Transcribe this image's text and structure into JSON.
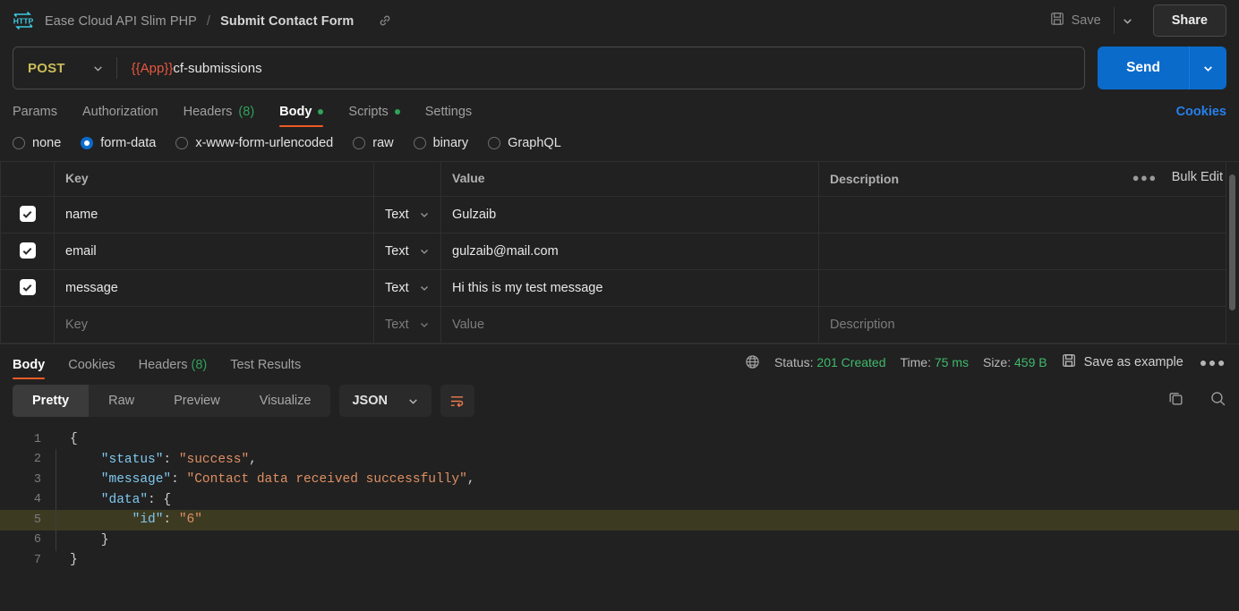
{
  "topbar": {
    "logo_icon": "http-logo-icon",
    "collection": "Ease Cloud API Slim PHP",
    "separator": "/",
    "request_name": "Submit Contact Form",
    "link_icon": "link-icon",
    "save_label": "Save",
    "save_icon": "floppy-disk-icon",
    "save_caret_icon": "chevron-down-icon",
    "share_label": "Share"
  },
  "url": {
    "method": "POST",
    "method_caret_icon": "chevron-down-icon",
    "variable": "{{App}}",
    "path": "cf-submissions",
    "send_label": "Send",
    "send_caret_icon": "chevron-down-icon"
  },
  "request_tabs": {
    "items": [
      {
        "label": "Params",
        "count": "",
        "dot": false,
        "active": false
      },
      {
        "label": "Authorization",
        "count": "",
        "dot": false,
        "active": false
      },
      {
        "label": "Headers",
        "count": "(8)",
        "dot": false,
        "active": false
      },
      {
        "label": "Body",
        "count": "",
        "dot": true,
        "active": true
      },
      {
        "label": "Scripts",
        "count": "",
        "dot": true,
        "active": false
      },
      {
        "label": "Settings",
        "count": "",
        "dot": false,
        "active": false
      }
    ],
    "cookies_label": "Cookies"
  },
  "body_types": [
    {
      "label": "none",
      "selected": false
    },
    {
      "label": "form-data",
      "selected": true
    },
    {
      "label": "x-www-form-urlencoded",
      "selected": false
    },
    {
      "label": "raw",
      "selected": false
    },
    {
      "label": "binary",
      "selected": false
    },
    {
      "label": "GraphQL",
      "selected": false
    }
  ],
  "form_table": {
    "headers": {
      "key": "Key",
      "value": "Value",
      "description": "Description"
    },
    "more_icon": "ellipsis-icon",
    "bulk_edit_label": "Bulk Edit",
    "rows": [
      {
        "checked": true,
        "key": "name",
        "type": "Text",
        "value": "Gulzaib",
        "description": ""
      },
      {
        "checked": true,
        "key": "email",
        "type": "Text",
        "value": "gulzaib@mail.com",
        "description": ""
      },
      {
        "checked": true,
        "key": "message",
        "type": "Text",
        "value": "Hi this is my test message",
        "description": ""
      }
    ],
    "placeholder_row": {
      "key": "Key",
      "type": "Text",
      "value": "Value",
      "description": "Description"
    }
  },
  "response": {
    "tabs": [
      {
        "label": "Body",
        "count": "",
        "active": true
      },
      {
        "label": "Cookies",
        "count": "",
        "active": false
      },
      {
        "label": "Headers",
        "count": "(8)",
        "active": false
      },
      {
        "label": "Test Results",
        "count": "",
        "active": false
      }
    ],
    "globe_icon": "globe-icon",
    "status_label": "Status:",
    "status_value": "201 Created",
    "time_label": "Time:",
    "time_value": "75 ms",
    "size_label": "Size:",
    "size_value": "459 B",
    "save_example_icon": "floppy-disk-icon",
    "save_example_label": "Save as example",
    "more_icon": "ellipsis-icon",
    "view_modes": [
      {
        "label": "Pretty",
        "active": true
      },
      {
        "label": "Raw",
        "active": false
      },
      {
        "label": "Preview",
        "active": false
      },
      {
        "label": "Visualize",
        "active": false
      }
    ],
    "format": "JSON",
    "format_caret_icon": "chevron-down-icon",
    "wrap_icon": "wrap-lines-icon",
    "copy_icon": "copy-icon",
    "search_icon": "search-icon",
    "body_lines": [
      {
        "n": "1",
        "indent": false,
        "highlight": false,
        "parts": [
          {
            "t": "{",
            "c": "p"
          }
        ]
      },
      {
        "n": "2",
        "indent": true,
        "highlight": false,
        "parts": [
          {
            "t": "    \"status\"",
            "c": "k"
          },
          {
            "t": ": ",
            "c": "p"
          },
          {
            "t": "\"success\"",
            "c": "s"
          },
          {
            "t": ",",
            "c": "p"
          }
        ]
      },
      {
        "n": "3",
        "indent": true,
        "highlight": false,
        "parts": [
          {
            "t": "    \"message\"",
            "c": "k"
          },
          {
            "t": ": ",
            "c": "p"
          },
          {
            "t": "\"Contact data received successfully\"",
            "c": "s"
          },
          {
            "t": ",",
            "c": "p"
          }
        ]
      },
      {
        "n": "4",
        "indent": true,
        "highlight": false,
        "parts": [
          {
            "t": "    \"data\"",
            "c": "k"
          },
          {
            "t": ": {",
            "c": "p"
          }
        ]
      },
      {
        "n": "5",
        "indent": true,
        "highlight": true,
        "parts": [
          {
            "t": "        \"id\"",
            "c": "k"
          },
          {
            "t": ": ",
            "c": "p"
          },
          {
            "t": "\"6\"",
            "c": "s"
          }
        ]
      },
      {
        "n": "6",
        "indent": true,
        "highlight": false,
        "parts": [
          {
            "t": "    }",
            "c": "p"
          }
        ]
      },
      {
        "n": "7",
        "indent": false,
        "highlight": false,
        "parts": [
          {
            "t": "}",
            "c": "p"
          }
        ]
      }
    ]
  },
  "colors": {
    "background": "#212121",
    "accent_orange": "#ef5b25",
    "send_blue": "#0b6bcb",
    "success_green": "#3fb96b",
    "method_yellow": "#cbbd5a",
    "variable_red": "#e8573f",
    "json_key": "#7fc8f0",
    "json_string": "#e08f63"
  }
}
